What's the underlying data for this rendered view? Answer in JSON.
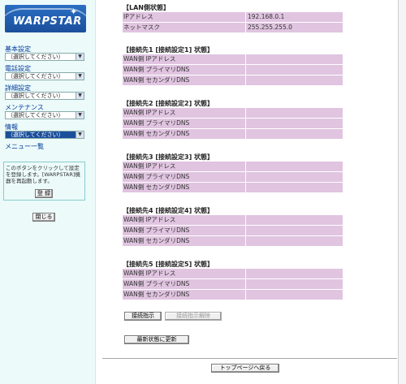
{
  "sidebar": {
    "logo_text": "WARPSTAR",
    "menus": [
      {
        "label": "基本設定",
        "selected": "（選択してください）"
      },
      {
        "label": "電話設定",
        "selected": "（選択してください）"
      },
      {
        "label": "詳細設定",
        "selected": "（選択してください）"
      },
      {
        "label": "メンテナンス",
        "selected": "（選択してください）"
      },
      {
        "label": "情報",
        "selected": "（選択してください）"
      }
    ],
    "menu_list_link": "メニュー一覧",
    "register_text": "このボタンをクリックして設定を登録します。[WARPSTAR]機器を再起動します。",
    "register_button": "登 録",
    "close_button": "閉じる"
  },
  "main": {
    "lan": {
      "title": "【LAN側状態】",
      "rows": [
        {
          "label": "IPアドレス",
          "value": "192.168.0.1"
        },
        {
          "label": "ネットマスク",
          "value": "255.255.255.0"
        }
      ]
    },
    "connections": [
      {
        "title": "【接続先1 [接続設定1] 状態】",
        "rows": [
          "WAN側 IPアドレス",
          "WAN側 プライマリDNS",
          "WAN側 セカンダリDNS"
        ]
      },
      {
        "title": "【接続先2 [接続設定2] 状態】",
        "rows": [
          "WAN側 IPアドレス",
          "WAN側 プライマリDNS",
          "WAN側 セカンダリDNS"
        ]
      },
      {
        "title": "【接続先3 [接続設定3] 状態】",
        "rows": [
          "WAN側 IPアドレス",
          "WAN側 プライマリDNS",
          "WAN側 セカンダリDNS"
        ]
      },
      {
        "title": "【接続先4 [接続設定4] 状態】",
        "rows": [
          "WAN側 IPアドレス",
          "WAN側 プライマリDNS",
          "WAN側 セカンダリDNS"
        ]
      },
      {
        "title": "【接続先5 [接続設定5] 状態】",
        "rows": [
          "WAN側 IPアドレス",
          "WAN側 プライマリDNS",
          "WAN側 セカンダリDNS"
        ]
      }
    ],
    "connect_button": "接続指示",
    "disconnect_button": "接続指示解除",
    "refresh_button": "最新状態に更新",
    "top_button": "トップページへ戻る"
  },
  "colors": {
    "sidebar_bg": "#ecfafa",
    "row_bg": "#e0c4e0",
    "link": "#003a9c",
    "logo": "#1b4f9c"
  },
  "icons": {
    "dropdown": "chevron-down-icon",
    "logo_star": "star-icon"
  }
}
